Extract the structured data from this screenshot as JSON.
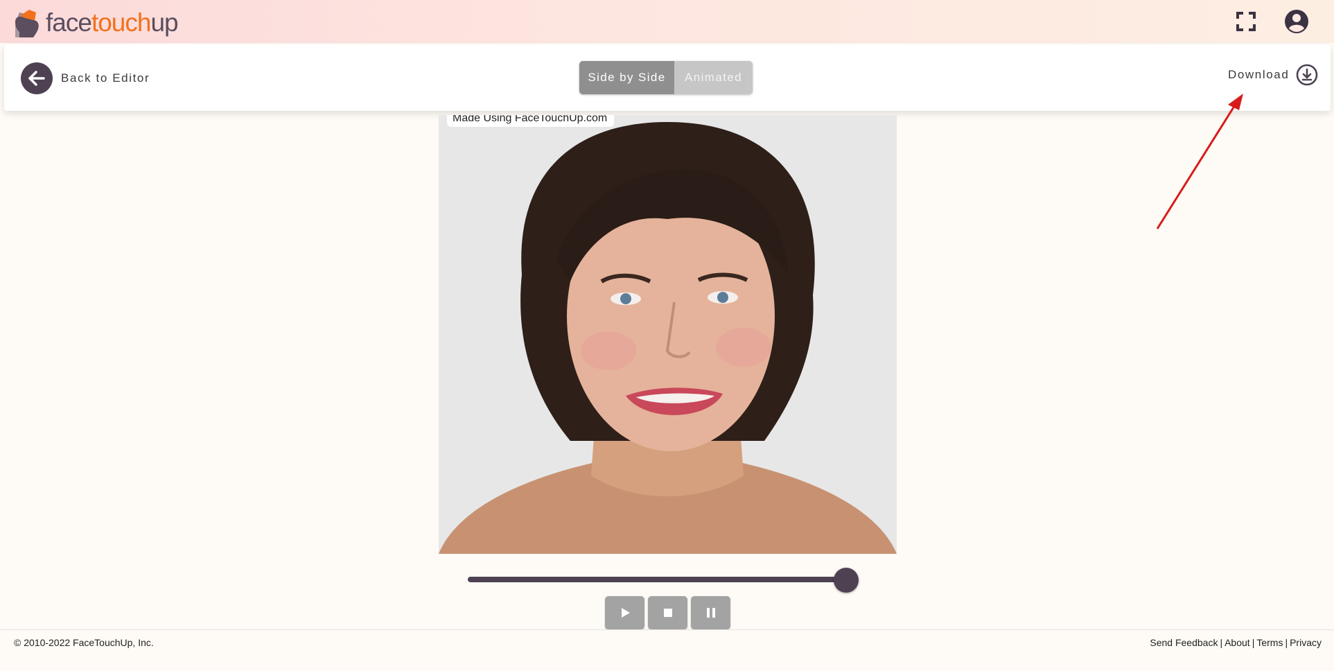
{
  "brand": {
    "logo_text_1": "face",
    "logo_text_2": "touch",
    "logo_text_3": "up",
    "accent_color": "#f2711c",
    "primary_color": "#4d4152"
  },
  "header": {
    "icons": [
      "fullscreen-icon",
      "account-icon"
    ]
  },
  "toolbar": {
    "back_label": "Back to Editor",
    "view_modes": [
      "Side by Side",
      "Animated"
    ],
    "selected_view": "Side by Side",
    "download_label": "Download"
  },
  "preview": {
    "watermark": "Made Using FaceTouchUp.com"
  },
  "player": {
    "slider_value": 0.95,
    "controls": [
      "play-icon",
      "stop-icon",
      "pause-icon"
    ]
  },
  "footer": {
    "copyright": "© 2010-2022 FaceTouchUp, Inc.",
    "links": [
      "Send Feedback",
      "About",
      "Terms",
      "Privacy"
    ],
    "separator": "|"
  }
}
